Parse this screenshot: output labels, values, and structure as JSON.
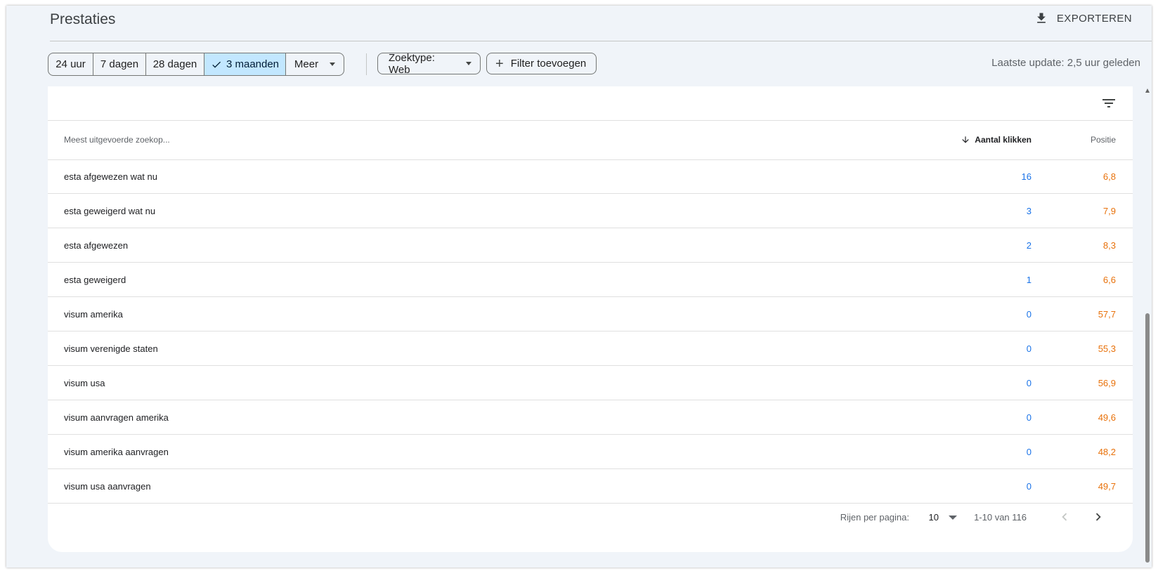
{
  "header": {
    "title": "Prestaties",
    "export_label": "EXPORTEREN"
  },
  "toolbar": {
    "date_ranges": [
      {
        "label": "24 uur",
        "selected": false
      },
      {
        "label": "7 dagen",
        "selected": false
      },
      {
        "label": "28 dagen",
        "selected": false
      },
      {
        "label": "3 maanden",
        "selected": true
      },
      {
        "label": "Meer",
        "selected": false
      }
    ],
    "search_type": "Zoektype: Web",
    "add_filter": "Filter toevoegen",
    "last_update": "Laatste update: 2,5 uur geleden"
  },
  "table": {
    "columns": {
      "query": "Meest uitgevoerde zoekop...",
      "clicks": "Aantal klikken",
      "position": "Positie"
    },
    "rows": [
      {
        "query": "esta afgewezen wat nu",
        "clicks": "16",
        "position": "6,8"
      },
      {
        "query": "esta geweigerd wat nu",
        "clicks": "3",
        "position": "7,9"
      },
      {
        "query": "esta afgewezen",
        "clicks": "2",
        "position": "8,3"
      },
      {
        "query": "esta geweigerd",
        "clicks": "1",
        "position": "6,6"
      },
      {
        "query": "visum amerika",
        "clicks": "0",
        "position": "57,7"
      },
      {
        "query": "visum verenigde staten",
        "clicks": "0",
        "position": "55,3"
      },
      {
        "query": "visum usa",
        "clicks": "0",
        "position": "56,9"
      },
      {
        "query": "visum aanvragen amerika",
        "clicks": "0",
        "position": "49,6"
      },
      {
        "query": "visum amerika aanvragen",
        "clicks": "0",
        "position": "48,2"
      },
      {
        "query": "visum usa aanvragen",
        "clicks": "0",
        "position": "49,7"
      }
    ]
  },
  "pagination": {
    "rows_per_page_label": "Rijen per pagina:",
    "rows_per_page": "10",
    "range": "1-10 van 116"
  },
  "colors": {
    "clicks": "#1a73e8",
    "position": "#e8710a",
    "selected_chip": "#c2e7ff"
  }
}
